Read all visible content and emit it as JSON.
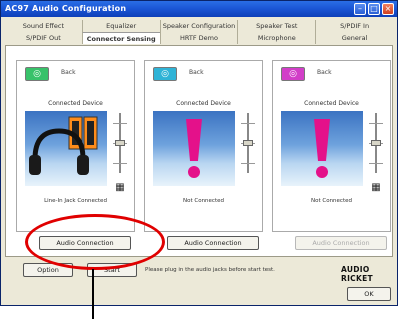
{
  "window": {
    "title": "AC97 Audio Configuration"
  },
  "tabs_row1": [
    "Sound Effect",
    "Equalizer",
    "Speaker Configuration",
    "Speaker Test",
    "S/PDIF In"
  ],
  "tabs_row2": [
    "S/PDIF Out",
    "Connector Sensing",
    "HRTF Demo",
    "Microphone",
    "General"
  ],
  "cards": [
    {
      "jack_label": "Back",
      "device_label": "Connected Device",
      "status": "Line-In Jack Connected",
      "button": "Audio Connection",
      "jack_color": "#38c26a",
      "button_enabled": true
    },
    {
      "jack_label": "Back",
      "device_label": "Connected Device",
      "status": "Not Connected",
      "button": "Audio Connection",
      "jack_color": "#2fb3d6",
      "button_enabled": true
    },
    {
      "jack_label": "Back",
      "device_label": "Connected Device",
      "status": "Not Connected",
      "button": "Audio Connection",
      "jack_color": "#d23ec8",
      "button_enabled": false
    }
  ],
  "bottom": {
    "option_label": "Option",
    "start_label": "Start",
    "note": "Please plug in the audio jacks before start test.",
    "brand": "AUDIO RICKET",
    "ok_label": "OK"
  },
  "colors": {
    "highlight": "#e00000",
    "title_bar": "#1a54d4",
    "exclamation": "#e4118a"
  },
  "icons": {
    "card1": "headphones-speakers",
    "card2": "exclamation",
    "card3": "exclamation"
  }
}
